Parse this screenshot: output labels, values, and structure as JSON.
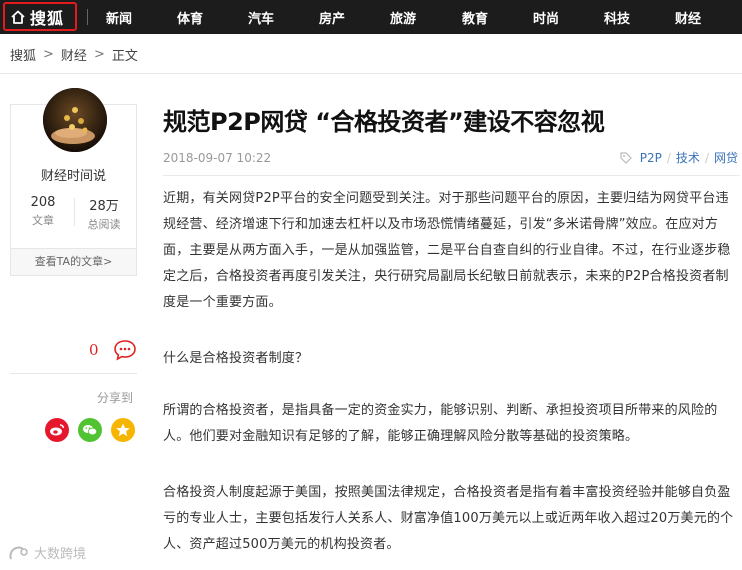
{
  "nav": {
    "logo_text": "搜狐",
    "items": [
      "新闻",
      "体育",
      "汽车",
      "房产",
      "旅游",
      "教育",
      "时尚",
      "科技",
      "财经"
    ]
  },
  "breadcrumb": {
    "home": "搜狐",
    "section": "财经",
    "current": "正文",
    "separator": ">"
  },
  "author": {
    "name": "财经时间说",
    "articles_count": "208",
    "articles_label": "文章",
    "reads_count": "28万",
    "reads_label": "总阅读",
    "see_more": "查看TA的文章>"
  },
  "comments": {
    "count": "0"
  },
  "share": {
    "label": "分享到"
  },
  "article": {
    "title": "规范P2P网贷 “合格投资者”建设不容忽视",
    "time": "2018-09-07 10:22",
    "tags": [
      "P2P",
      "技术",
      "网贷"
    ],
    "paragraphs": [
      "近期，有关网贷P2P平台的安全问题受到关注。对于那些问题平台的原因，主要归结为网贷平台违规经营、经济增速下行和加速去杠杆以及市场恐慌情绪蔓延，引发“多米诺骨牌”效应。在应对方面，主要是从两方面入手，一是从加强监管，二是平台自查自纠的行业自律。不过，在行业逐步稳定之后，合格投资者再度引发关注，央行研究局副局长纪敏日前就表示，未来的P2P合格投资者制度是一个重要方面。",
      "什么是合格投资者制度？",
      "所谓的合格投资者，是指具备一定的资金实力，能够识别、判断、承担投资项目所带来的风险的人。他们要对金融知识有足够的了解，能够正确理解风险分散等基础的投资策略。",
      "合格投资人制度起源于美国，按照美国法律规定，合格投资者是指有着丰富投资经验并能够自负盈亏的专业人士，主要包括发行人关系人、财富净值100万美元以上或近两年收入超过20万美元的个人、资产超过500万美元的机构投资者。"
    ]
  },
  "watermark": {
    "text": "大数跨境"
  },
  "colors": {
    "topbar": "#1c1c1c",
    "logo_border": "#e21c1c",
    "tag_link": "#3b73b9",
    "comment_count": "#dd2222",
    "weibo": "#e6162d",
    "wechat": "#51c332",
    "qzone": "#f6b500"
  }
}
